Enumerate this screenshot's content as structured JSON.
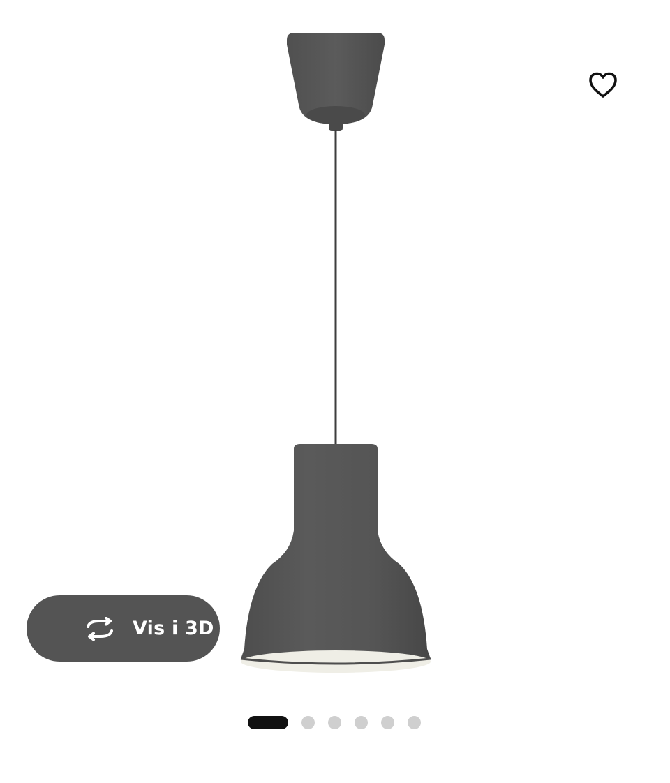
{
  "product": {
    "image_name": "pendant-lamp",
    "lamp_color": "#545454",
    "lamp_inner_color": "#efeee6"
  },
  "favourite": {
    "icon": "heart-outline-icon"
  },
  "view_3d": {
    "icon": "rotate-3d-icon",
    "label": "Vis i 3D",
    "background": "#545454"
  },
  "carousel": {
    "total_images": 6,
    "active_index": 0,
    "active_color": "#111111",
    "inactive_color": "#cfcfcf"
  }
}
